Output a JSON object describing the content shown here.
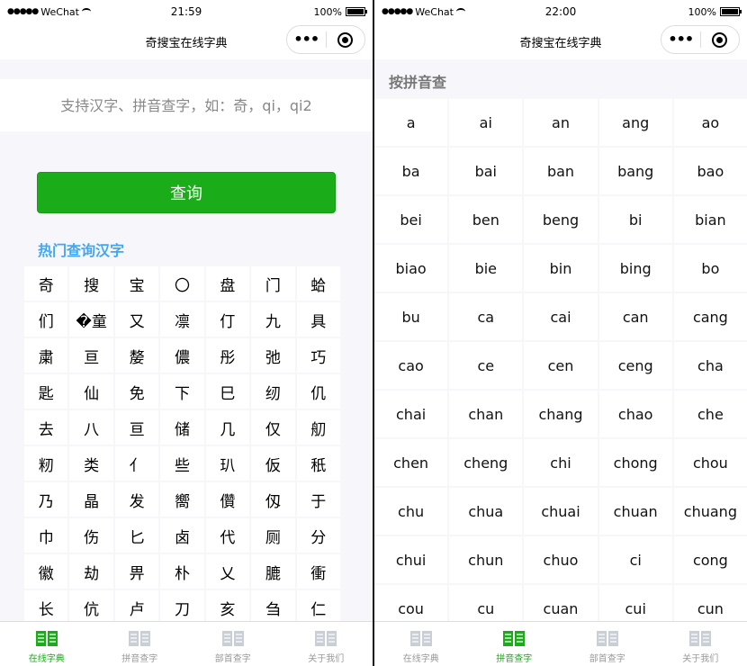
{
  "left": {
    "status": {
      "carrier": "WeChat",
      "time": "21:59",
      "battery": "100%"
    },
    "nav_title": "奇搜宝在线字典",
    "search_placeholder": "支持汉字、拼音查字，如：奇，qi，qi2",
    "query_label": "查询",
    "hot_title": "热门查询汉字",
    "hot_chars": [
      "奇",
      "搜",
      "宝",
      "〇",
      "盘",
      "门",
      "蛤",
      "们",
      "�童",
      "又",
      "凛",
      "仃",
      "九",
      "具",
      "粛",
      "亘",
      "嫠",
      "儂",
      "彤",
      "弛",
      "巧",
      "匙",
      "仙",
      "免",
      "下",
      "巳",
      "纫",
      "仉",
      "去",
      "八",
      "亘",
      "储",
      "几",
      "仅",
      "舠",
      "籾",
      "类",
      "亻",
      "些",
      "玐",
      "仮",
      "秖",
      "乃",
      "晶",
      "发",
      "嚮",
      "儹",
      "仭",
      "于",
      "巾",
      "伤",
      "匕",
      "卤",
      "代",
      "厕",
      "分",
      "徽",
      "劫",
      "畀",
      "朴",
      "乂",
      "膔",
      "衝",
      "长",
      "伉",
      "卢",
      "刀",
      "亥",
      "刍",
      "仁"
    ],
    "tabs": [
      {
        "label": "在线字典",
        "active": true
      },
      {
        "label": "拼音查字",
        "active": false
      },
      {
        "label": "部首查字",
        "active": false
      },
      {
        "label": "关于我们",
        "active": false
      }
    ]
  },
  "right": {
    "status": {
      "carrier": "WeChat",
      "time": "22:00",
      "battery": "100%"
    },
    "nav_title": "奇搜宝在线字典",
    "pinyin_title": "按拼音查",
    "pinyin": [
      "a",
      "ai",
      "an",
      "ang",
      "ao",
      "ba",
      "bai",
      "ban",
      "bang",
      "bao",
      "bei",
      "ben",
      "beng",
      "bi",
      "bian",
      "biao",
      "bie",
      "bin",
      "bing",
      "bo",
      "bu",
      "ca",
      "cai",
      "can",
      "cang",
      "cao",
      "ce",
      "cen",
      "ceng",
      "cha",
      "chai",
      "chan",
      "chang",
      "chao",
      "che",
      "chen",
      "cheng",
      "chi",
      "chong",
      "chou",
      "chu",
      "chua",
      "chuai",
      "chuan",
      "chuang",
      "chui",
      "chun",
      "chuo",
      "ci",
      "cong",
      "cou",
      "cu",
      "cuan",
      "cui",
      "cun"
    ],
    "tabs": [
      {
        "label": "在线字典",
        "active": false
      },
      {
        "label": "拼音查字",
        "active": true
      },
      {
        "label": "部首查字",
        "active": false
      },
      {
        "label": "关于我们",
        "active": false
      }
    ]
  },
  "colors": {
    "primary": "#1aad19",
    "hot_title": "#3fa7f5",
    "tab_inactive": "#999999"
  }
}
